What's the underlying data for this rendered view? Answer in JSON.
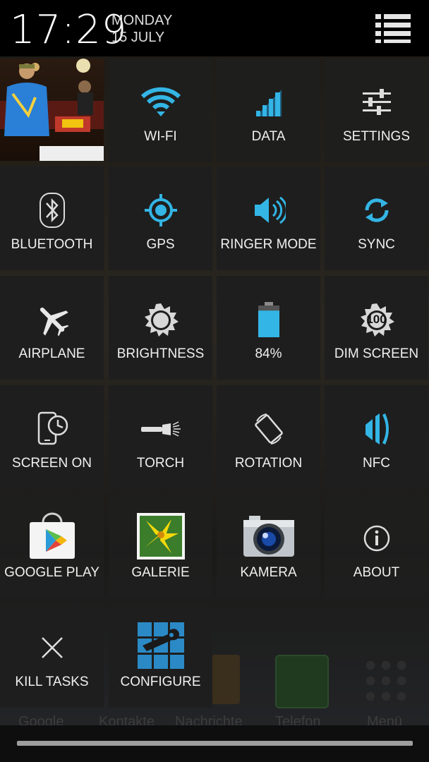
{
  "status": {
    "time": "17:29",
    "day": "MONDAY",
    "date": "15 JULY"
  },
  "tiles": [
    {
      "label": "WI-FI",
      "icon": "wifi-icon"
    },
    {
      "label": "DATA",
      "icon": "signal-bars-icon"
    },
    {
      "label": "SETTINGS",
      "icon": "sliders-icon"
    },
    {
      "label": "BLUETOOTH",
      "icon": "bluetooth-icon"
    },
    {
      "label": "GPS",
      "icon": "gps-icon"
    },
    {
      "label": "RINGER MODE",
      "icon": "speaker-icon"
    },
    {
      "label": "SYNC",
      "icon": "sync-icon"
    },
    {
      "label": "AIRPLANE",
      "icon": "airplane-icon"
    },
    {
      "label": "BRIGHTNESS",
      "icon": "sun-icon"
    },
    {
      "label": "84%",
      "icon": "battery-icon"
    },
    {
      "label": "DIM SCREEN",
      "icon": "dim-screen-icon",
      "badge": "100"
    },
    {
      "label": "SCREEN ON",
      "icon": "phone-clock-icon"
    },
    {
      "label": "TORCH",
      "icon": "flashlight-icon"
    },
    {
      "label": "ROTATION",
      "icon": "rotation-icon"
    },
    {
      "label": "NFC",
      "icon": "nfc-icon"
    },
    {
      "label": "GOOGLE PLAY",
      "icon": "play-store-icon"
    },
    {
      "label": "GALERIE",
      "icon": "gallery-icon"
    },
    {
      "label": "KAMERA",
      "icon": "camera-icon"
    },
    {
      "label": "ABOUT",
      "icon": "info-icon"
    },
    {
      "label": "KILL TASKS",
      "icon": "close-icon"
    },
    {
      "label": "CONFIGURE",
      "icon": "configure-icon"
    }
  ],
  "battery_level": 0.84,
  "dock": {
    "labels": [
      "Google",
      "Kontakte",
      "Nachrichte",
      "Telefon",
      "Menü"
    ]
  },
  "colors": {
    "accent": "#33b5e5",
    "tile_bg": "#1e1e1e",
    "statusbar": "#000000"
  }
}
